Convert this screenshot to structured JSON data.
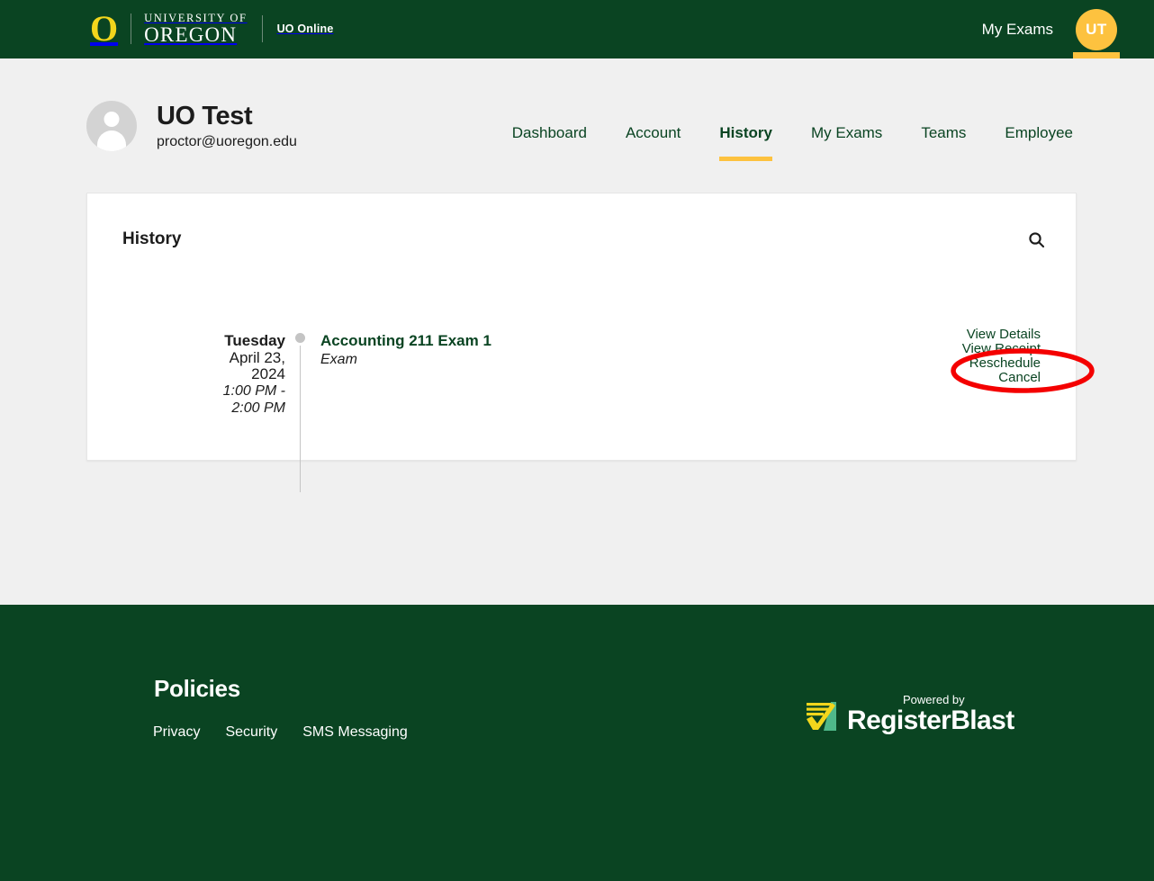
{
  "topbar": {
    "logo": {
      "letter": "O",
      "university": "UNIVERSITY OF",
      "name": "OREGON",
      "sub_brand": "UO Online"
    },
    "my_exams_label": "My Exams",
    "avatar_initials": "UT"
  },
  "profile": {
    "name": "UO Test",
    "email": "proctor@uoregon.edu"
  },
  "mainnav": {
    "items": [
      {
        "label": "Dashboard",
        "active": false
      },
      {
        "label": "Account",
        "active": false
      },
      {
        "label": "History",
        "active": true
      },
      {
        "label": "My Exams",
        "active": false
      },
      {
        "label": "Teams",
        "active": false
      },
      {
        "label": "Employee",
        "active": false
      }
    ]
  },
  "card": {
    "title": "History",
    "search_icon": "search-icon"
  },
  "entry": {
    "day": "Tuesday",
    "date_line1": "April 23,",
    "date_line2": "2024",
    "time_line1": "1:00 PM -",
    "time_line2": "2:00 PM",
    "title": "Accounting 211 Exam 1",
    "type": "Exam",
    "actions": [
      {
        "label": "View Details"
      },
      {
        "label": "View Receipt"
      },
      {
        "label": "Reschedule"
      },
      {
        "label": "Cancel"
      }
    ]
  },
  "annotation": {
    "shape": "ellipse",
    "color": "#f40000",
    "targets": "Cancel"
  },
  "footer": {
    "title": "Policies",
    "links": [
      {
        "label": "Privacy"
      },
      {
        "label": "Security"
      },
      {
        "label": "SMS Messaging"
      }
    ],
    "powered_by": "Powered by",
    "brand": "RegisterBlast"
  },
  "colors": {
    "brand_green": "#0a4422",
    "brand_gold": "#fdc23f",
    "logo_yellow": "#f2d61c",
    "page_bg": "#f0f0f0",
    "annotation_red": "#f40000"
  }
}
